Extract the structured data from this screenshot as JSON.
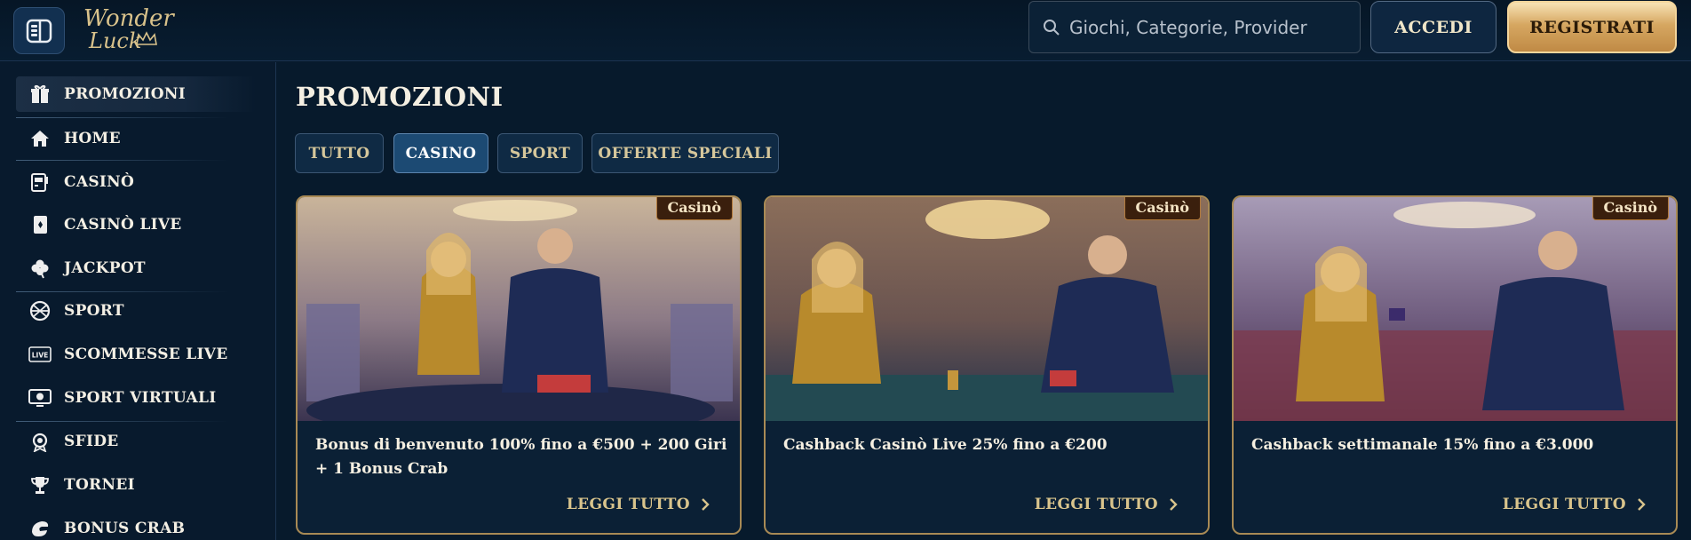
{
  "header": {
    "logo_line1": "Wonder",
    "logo_line2": "Luck",
    "search_placeholder": "Giochi, Categorie, Provider",
    "login_label": "ACCEDI",
    "register_label": "REGISTRATI"
  },
  "sidebar": {
    "items": [
      {
        "label": "PROMOZIONI",
        "icon": "gift-icon"
      },
      {
        "label": "HOME",
        "icon": "home-icon"
      },
      {
        "label": "CASINÒ",
        "icon": "slot-machine-icon"
      },
      {
        "label": "CASINÒ LIVE",
        "icon": "playing-card-icon"
      },
      {
        "label": "JACKPOT",
        "icon": "clover-icon"
      },
      {
        "label": "SPORT",
        "icon": "basketball-icon"
      },
      {
        "label": "SCOMMESSE LIVE",
        "icon": "live-badge-icon"
      },
      {
        "label": "SPORT VIRTUALI",
        "icon": "virtual-screen-icon"
      },
      {
        "label": "SFIDE",
        "icon": "medal-icon"
      },
      {
        "label": "TORNEI",
        "icon": "trophy-icon"
      },
      {
        "label": "BONUS CRAB",
        "icon": "crab-claw-icon"
      }
    ]
  },
  "main": {
    "title": "PROMOZIONI",
    "tabs": [
      {
        "label": "TUTTO"
      },
      {
        "label": "CASINO"
      },
      {
        "label": "SPORT"
      },
      {
        "label": "OFFERTE SPECIALI"
      }
    ],
    "cards": [
      {
        "badge": "Casinò",
        "title": "Bonus di benvenuto 100% fino a €500 + 200 Giri + 1 Bonus Crab",
        "link": "LEGGI TUTTO"
      },
      {
        "badge": "Casinò",
        "title": "Cashback Casinò Live 25% fino a €200",
        "link": "LEGGI TUTTO"
      },
      {
        "badge": "Casinò",
        "title": "Cashback settimanale 15% fino a €3.000",
        "link": "LEGGI TUTTO"
      }
    ]
  },
  "colors": {
    "background": "#071a2c",
    "gold": "#d9c48c",
    "active_tab": "#1c4a73",
    "register_gold": "#d6a761"
  }
}
